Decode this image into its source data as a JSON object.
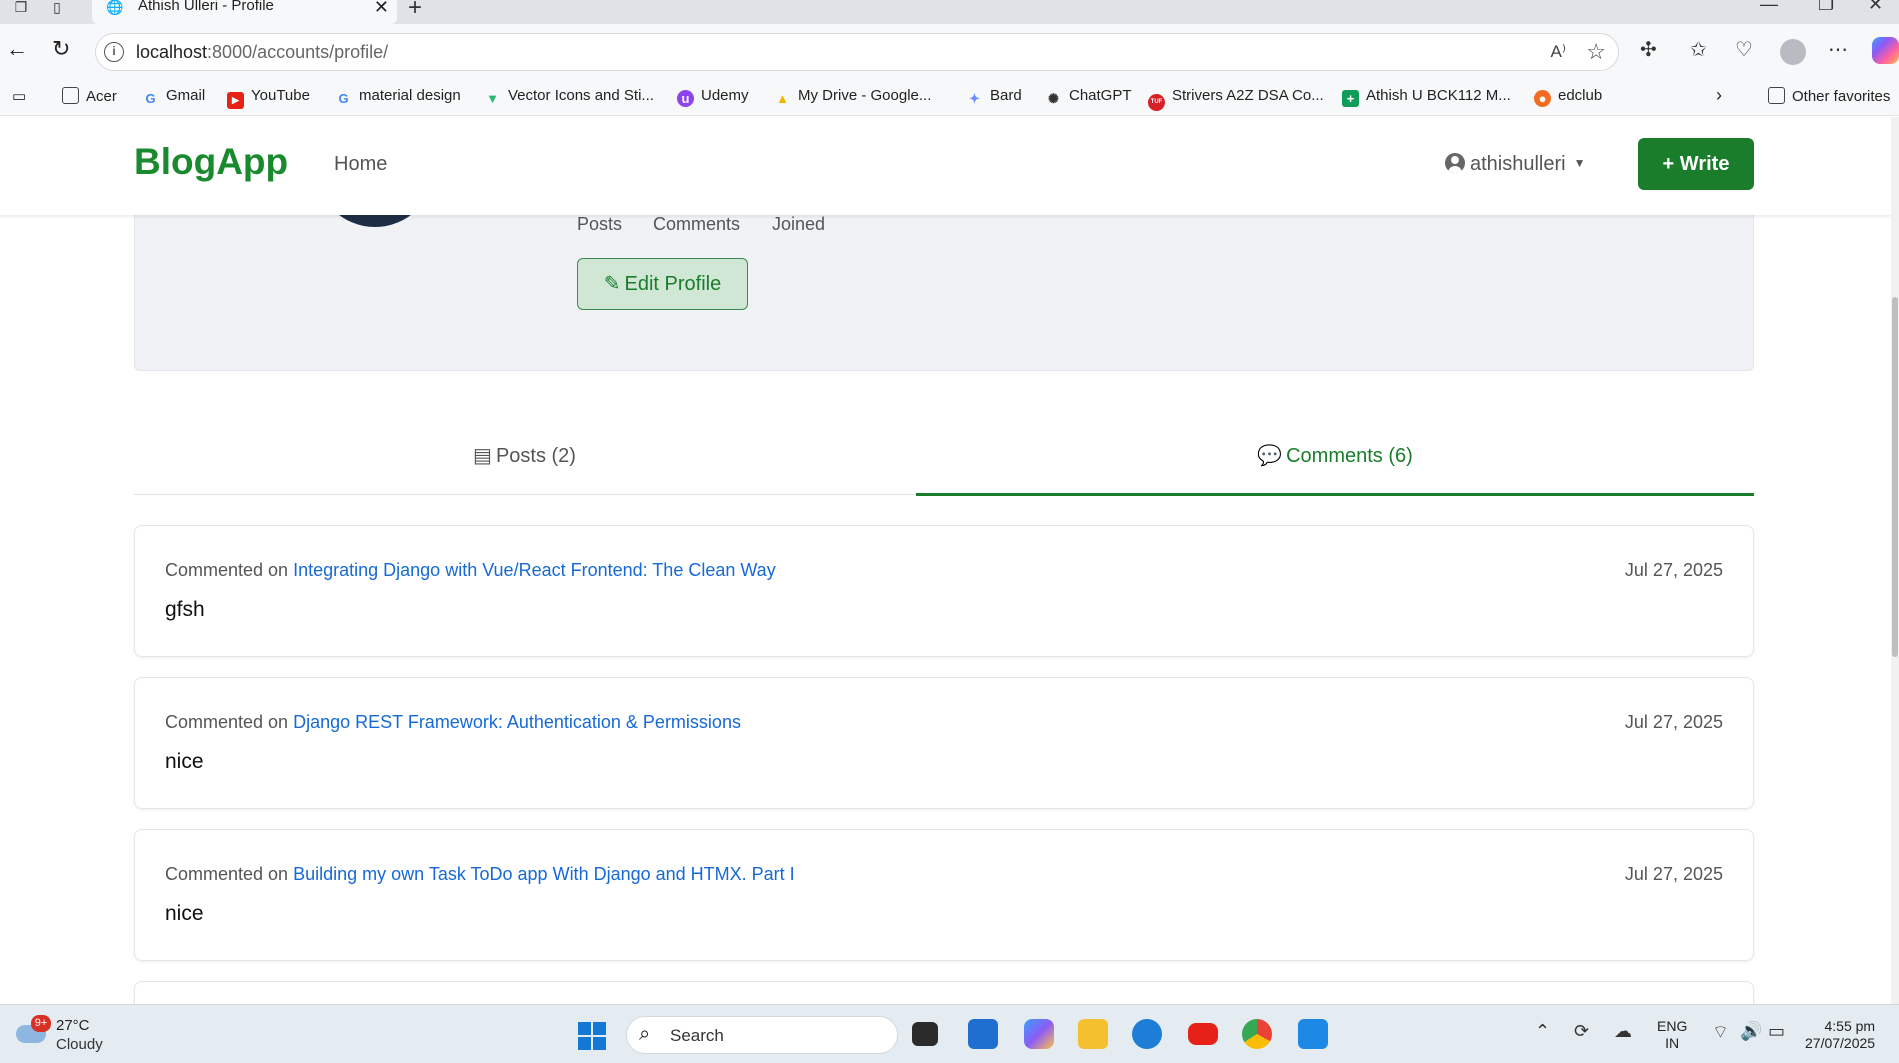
{
  "browser": {
    "tab_title": "Athish Ulleri - Profile",
    "url_host": "localhost",
    "url_rest": ":8000/accounts/profile/",
    "bookmarks": [
      {
        "label": "Acer",
        "icon": "folder-icon"
      },
      {
        "label": "Gmail",
        "icon": "google-icon"
      },
      {
        "label": "YouTube",
        "icon": "youtube-icon"
      },
      {
        "label": "material design",
        "icon": "google-icon"
      },
      {
        "label": "Vector Icons and Sti...",
        "icon": "vector-icon"
      },
      {
        "label": "Udemy",
        "icon": "udemy-icon"
      },
      {
        "label": "My Drive - Google...",
        "icon": "drive-icon"
      },
      {
        "label": "Bard",
        "icon": "bard-icon"
      },
      {
        "label": "ChatGPT",
        "icon": "chatgpt-icon"
      },
      {
        "label": "Strivers A2Z DSA Co...",
        "icon": "tuf-icon"
      },
      {
        "label": "Athish U BCK112 M...",
        "icon": "sheets-icon"
      },
      {
        "label": "edclub",
        "icon": "edclub-icon"
      }
    ],
    "other_favorites": "Other favorites"
  },
  "navbar": {
    "brand": "BlogApp",
    "home": "Home",
    "username": "athishulleri",
    "write": "Write"
  },
  "profile": {
    "stats": [
      "Posts",
      "Comments",
      "Joined"
    ],
    "edit_profile": "Edit Profile"
  },
  "tabs": {
    "posts": "Posts (2)",
    "comments": "Comments (6)"
  },
  "comments": [
    {
      "prefix": "Commented on",
      "post": "Integrating Django with Vue/React Frontend: The Clean Way",
      "date": "Jul 27, 2025",
      "text": "gfsh"
    },
    {
      "prefix": "Commented on",
      "post": "Django REST Framework: Authentication & Permissions",
      "date": "Jul 27, 2025",
      "text": "nice"
    },
    {
      "prefix": "Commented on",
      "post": "Building my own Task ToDo app With Django and HTMX. Part I",
      "date": "Jul 27, 2025",
      "text": "nice"
    }
  ],
  "taskbar": {
    "weather_badge": "9+",
    "temperature": "27°C",
    "condition": "Cloudy",
    "search": "Search",
    "lang_line1": "ENG",
    "lang_line2": "IN",
    "time": "4:55 pm",
    "date": "27/07/2025"
  },
  "colors": {
    "brand_green": "#1a8a2e",
    "button_green": "#1a7d2b",
    "link_blue": "#1669d6"
  }
}
